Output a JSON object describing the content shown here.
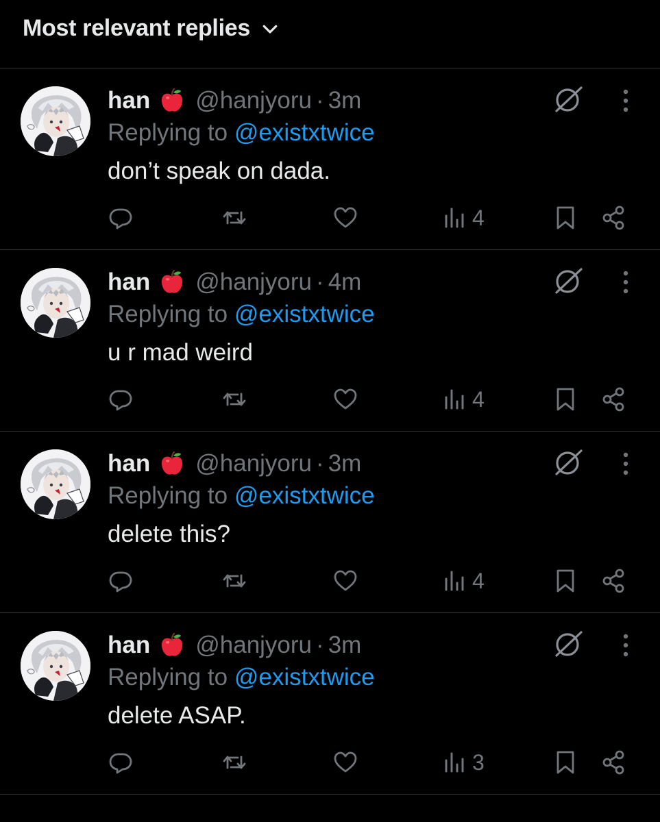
{
  "header": {
    "sort_label": "Most relevant replies"
  },
  "colors": {
    "background": "#000000",
    "primary_text": "#e7e9ea",
    "secondary_text": "#71767b",
    "link": "#1d9bf0",
    "divider": "#2f3336"
  },
  "replies": [
    {
      "name": "han",
      "emoji": "red-apple-icon",
      "handle": "@hanjyoru",
      "separator": "·",
      "time": "3m",
      "replying_prefix": "Replying to",
      "replying_to": "@existxtwice",
      "text": "don’t speak on dada.",
      "views": "4"
    },
    {
      "name": "han",
      "emoji": "red-apple-icon",
      "handle": "@hanjyoru",
      "separator": "·",
      "time": "4m",
      "replying_prefix": "Replying to",
      "replying_to": "@existxtwice",
      "text": "u r mad weird",
      "views": "4"
    },
    {
      "name": "han",
      "emoji": "red-apple-icon",
      "handle": "@hanjyoru",
      "separator": "·",
      "time": "3m",
      "replying_prefix": "Replying to",
      "replying_to": "@existxtwice",
      "text": "delete this?",
      "views": "4"
    },
    {
      "name": "han",
      "emoji": "red-apple-icon",
      "handle": "@hanjyoru",
      "separator": "·",
      "time": "3m",
      "replying_prefix": "Replying to",
      "replying_to": "@existxtwice",
      "text": "delete ASAP.",
      "views": "3"
    }
  ]
}
